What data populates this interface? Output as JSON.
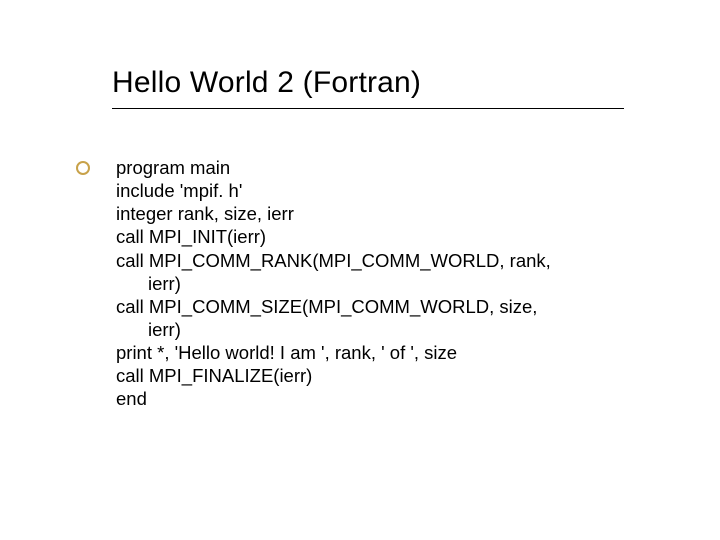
{
  "title": "Hello World 2 (Fortran)",
  "code": {
    "l1": "program main",
    "l2": "include 'mpif. h'",
    "l3": "integer rank, size, ierr",
    "l4": "call MPI_INIT(ierr)",
    "l5": "call MPI_COMM_RANK(MPI_COMM_WORLD, rank,",
    "l5b": "ierr)",
    "l6": "call MPI_COMM_SIZE(MPI_COMM_WORLD, size,",
    "l6b": "ierr)",
    "l7": "print *, 'Hello world! I am ', rank, ' of ', size",
    "l8": "call MPI_FINALIZE(ierr)",
    "l9": "end"
  }
}
